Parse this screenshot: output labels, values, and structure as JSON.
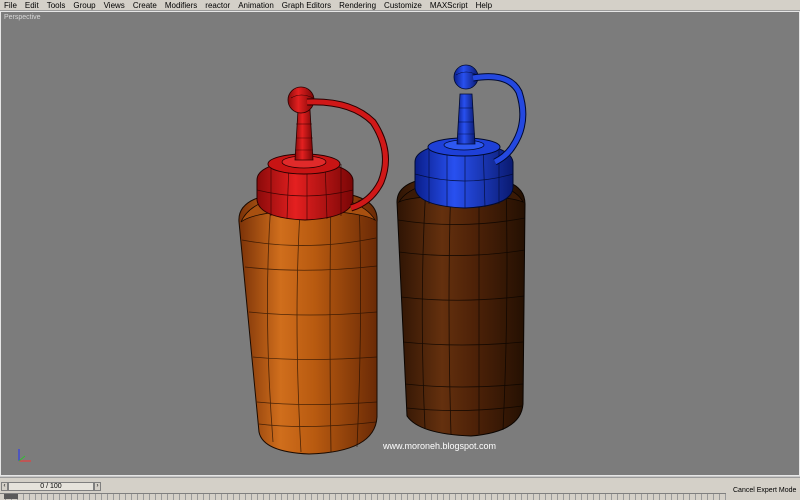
{
  "menu": {
    "items": [
      "File",
      "Edit",
      "Tools",
      "Group",
      "Views",
      "Create",
      "Modifiers",
      "reactor",
      "Animation",
      "Graph Editors",
      "Rendering",
      "Customize",
      "MAXScript",
      "Help"
    ]
  },
  "viewport": {
    "label": "Perspective",
    "watermark": "www.moroneh.blogspot.com",
    "background_color": "#7c7c7c"
  },
  "scene": {
    "bottle_left": {
      "cap_color": "#cc1a1a",
      "body_color": "#c86414"
    },
    "bottle_right": {
      "cap_color": "#1f3fd6",
      "body_color": "#5a2a0a"
    }
  },
  "timebar": {
    "frame_readout": "0 / 100",
    "status": "Cancel Expert Mode"
  }
}
